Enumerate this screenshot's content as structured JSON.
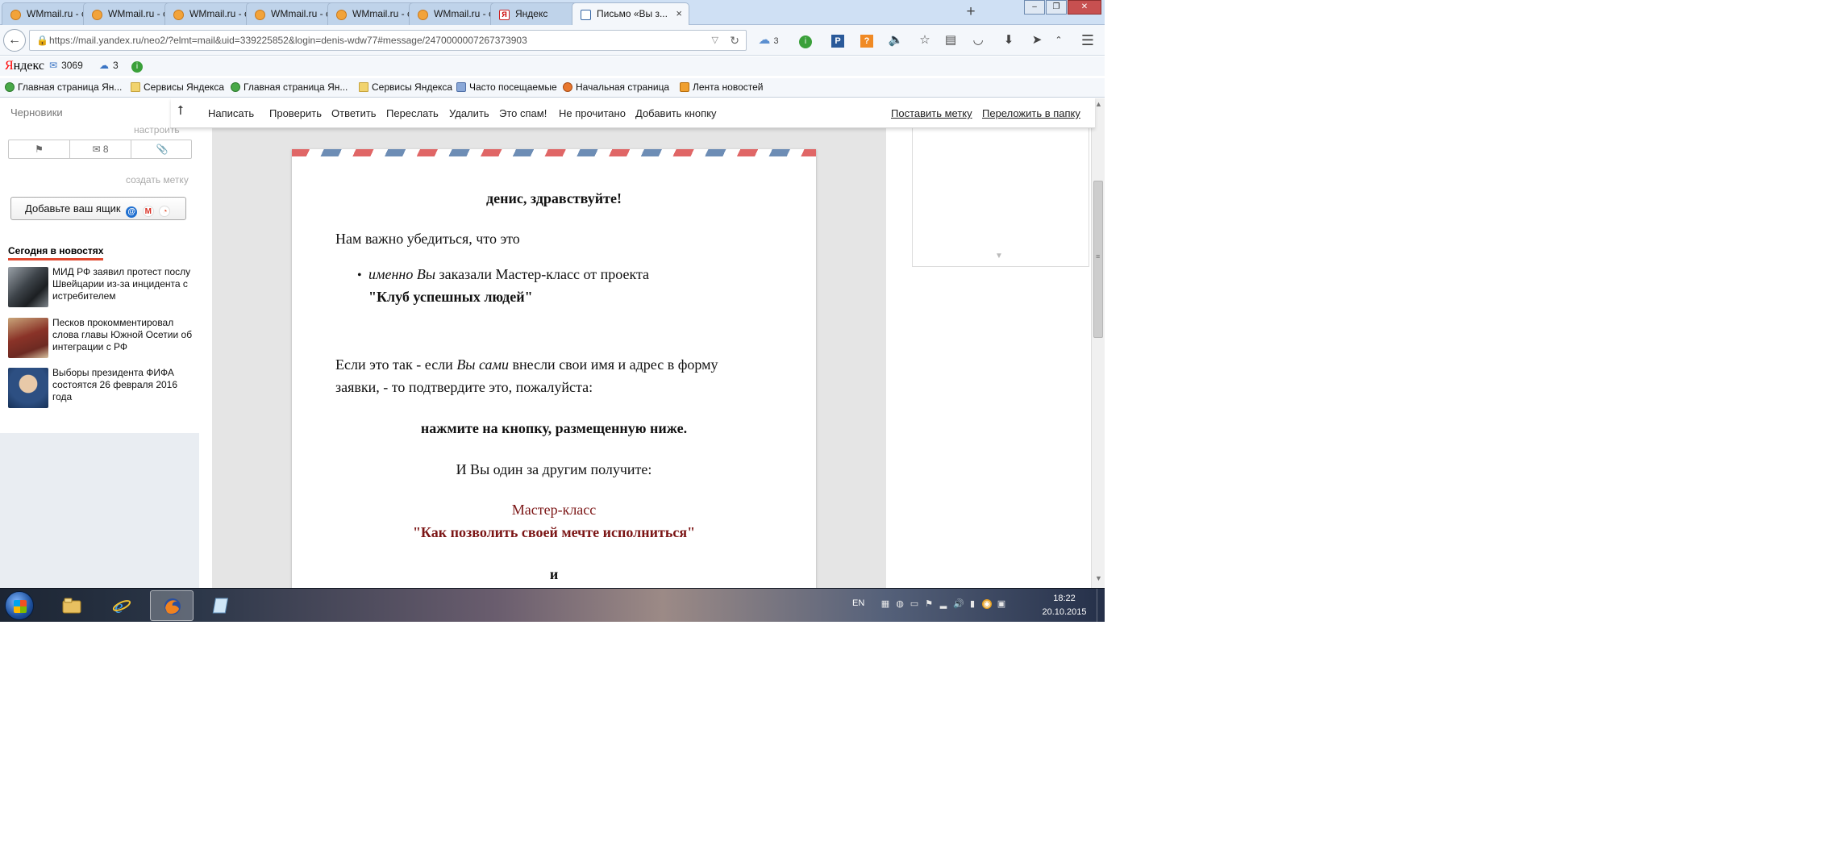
{
  "browser": {
    "tabs": [
      {
        "label": "WMmail.ru - с...",
        "icon": "wmmail-favicon"
      },
      {
        "label": "WMmail.ru - с...",
        "icon": "wmmail-favicon"
      },
      {
        "label": "WMmail.ru - с...",
        "icon": "wmmail-favicon"
      },
      {
        "label": "WMmail.ru - с...",
        "icon": "wmmail-favicon"
      },
      {
        "label": "WMmail.ru - с...",
        "icon": "wmmail-favicon"
      },
      {
        "label": "WMmail.ru - с...",
        "icon": "wmmail-favicon"
      },
      {
        "label": "Яндекс",
        "icon": "yandex-favicon"
      },
      {
        "label": "Письмо «Вы з...",
        "icon": "yandex-mail-favicon",
        "active": true
      }
    ],
    "tab_close": "×",
    "new_tab": "+",
    "url": "https://mail.yandex.ru/neo2/?elmt=mail&uid=339225852&login=denis-wdw77#message/2470000007267373903",
    "yandex_panel": {
      "logo_first": "Я",
      "logo_rest": "ндекс",
      "mail_count": "3069",
      "weather": "3"
    },
    "bookmarks": [
      "Главная страница Ян...",
      "Сервисы Яндекса",
      "Главная страница Ян...",
      "Сервисы Яндекса",
      "Часто посещаемые",
      "Начальная страница",
      "Лента новостей"
    ]
  },
  "nav_badges": {
    "weather": "3"
  },
  "mail": {
    "sidebar": {
      "drafts": "Черновики",
      "setup": "настроить",
      "mail_count": "8",
      "create_label": "создать метку",
      "add_box": "Добавьте ваш ящик",
      "news_heading": "Сегодня в новостях",
      "news": [
        "МИД РФ заявил протест послу Швейцарии из-за инцидента с истребителем",
        "Песков прокомментировал слова главы Южной Осетии об интеграции с РФ",
        "Выборы президента ФИФА состоятся 26 февраля 2016 года"
      ]
    },
    "toolbar": {
      "compose": "Написать",
      "check": "Проверить",
      "reply": "Ответить",
      "forward": "Переслать",
      "delete": "Удалить",
      "spam": "Это спам!",
      "unread": "Не прочитано",
      "add_button": "Добавить кнопку",
      "set_label": "Поставить метку",
      "move_folder": "Переложить в папку"
    },
    "letter": {
      "greeting": "денис, здравствуйте!",
      "intro": "Нам важно убедиться, что это",
      "bullet_italic": "именно Вы",
      "bullet_rest": " заказали Мастер-класс от проекта",
      "bullet_club": "\"Клуб успешных людей\"",
      "para_a": "Если это так - если ",
      "para_italic": "Вы сами",
      "para_b": " внесли свои имя и адрес в форму",
      "para_c": "заявки, - то подтвердите это, пожалуйста:",
      "press": "нажмите на кнопку, размещенную ниже.",
      "receive": "И Вы один за другим получите:",
      "master_class": "Мастер-класс",
      "mc_title": "\"Как позволить своей мечте исполниться\"",
      "and": "и"
    }
  },
  "taskbar": {
    "lang": "EN",
    "time": "18:22",
    "date": "20.10.2015"
  },
  "colors": {
    "accent_red": "#e0482f",
    "maroon_text": "#7b1515",
    "tabstrip_bg": "#cfe0f4"
  }
}
